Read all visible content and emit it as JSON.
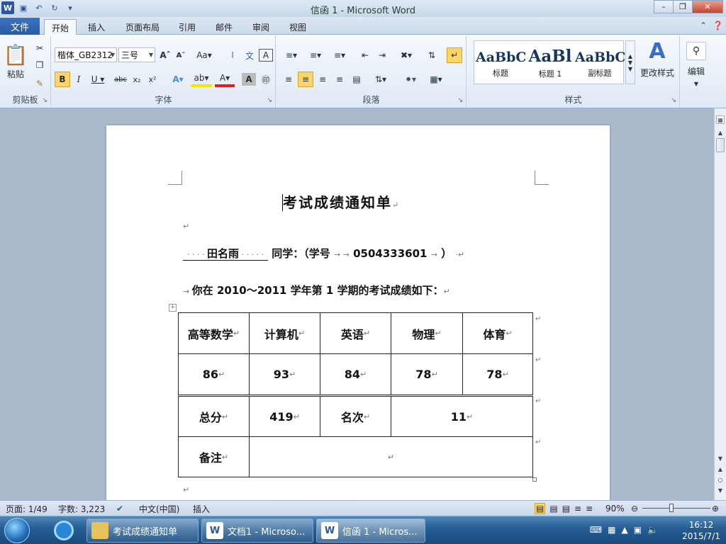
{
  "window": {
    "title": "信函 1 - Microsoft Word"
  },
  "tabs": {
    "file": "文件",
    "items": [
      "开始",
      "插入",
      "页面布局",
      "引用",
      "邮件",
      "审阅",
      "视图"
    ]
  },
  "ribbon": {
    "clipboard": {
      "paste": "粘贴",
      "label": "剪贴板"
    },
    "font": {
      "name": "楷体_GB2312",
      "size": "三号",
      "label": "字体"
    },
    "paragraph": {
      "label": "段落"
    },
    "styles": {
      "items": [
        {
          "preview": "AaBbC",
          "name": "标题"
        },
        {
          "preview": "AaBl",
          "name": "标题 1"
        },
        {
          "preview": "AaBbC",
          "name": "副标题"
        }
      ],
      "change": "更改样式",
      "label": "样式"
    },
    "editing": {
      "label": "编辑"
    }
  },
  "document": {
    "title": "考试成绩通知单",
    "name": "田名雨",
    "student_line_suffix": "同学：（学号",
    "student_id": "0504333601",
    "close_paren": "）",
    "intro": "你在 2010～2011 学年第 1 学期的考试成绩如下：",
    "table": {
      "subjects": [
        "高等数学",
        "计算机",
        "英语",
        "物理",
        "体育"
      ],
      "scores": [
        "86",
        "93",
        "84",
        "78",
        "78"
      ],
      "total_label": "总分",
      "total": "419",
      "rank_label": "名次",
      "rank": "11",
      "note_label": "备注",
      "note": ""
    }
  },
  "status": {
    "page": "页面: 1/49",
    "words": "字数: 3,223",
    "language": "中文(中国)",
    "mode": "插入",
    "zoom": "90%"
  },
  "taskbar": {
    "items": [
      "考试成绩通知单",
      "文档1 - Microso...",
      "信函 1 - Micros..."
    ],
    "time": "16:12",
    "date": "2015/7/1"
  }
}
